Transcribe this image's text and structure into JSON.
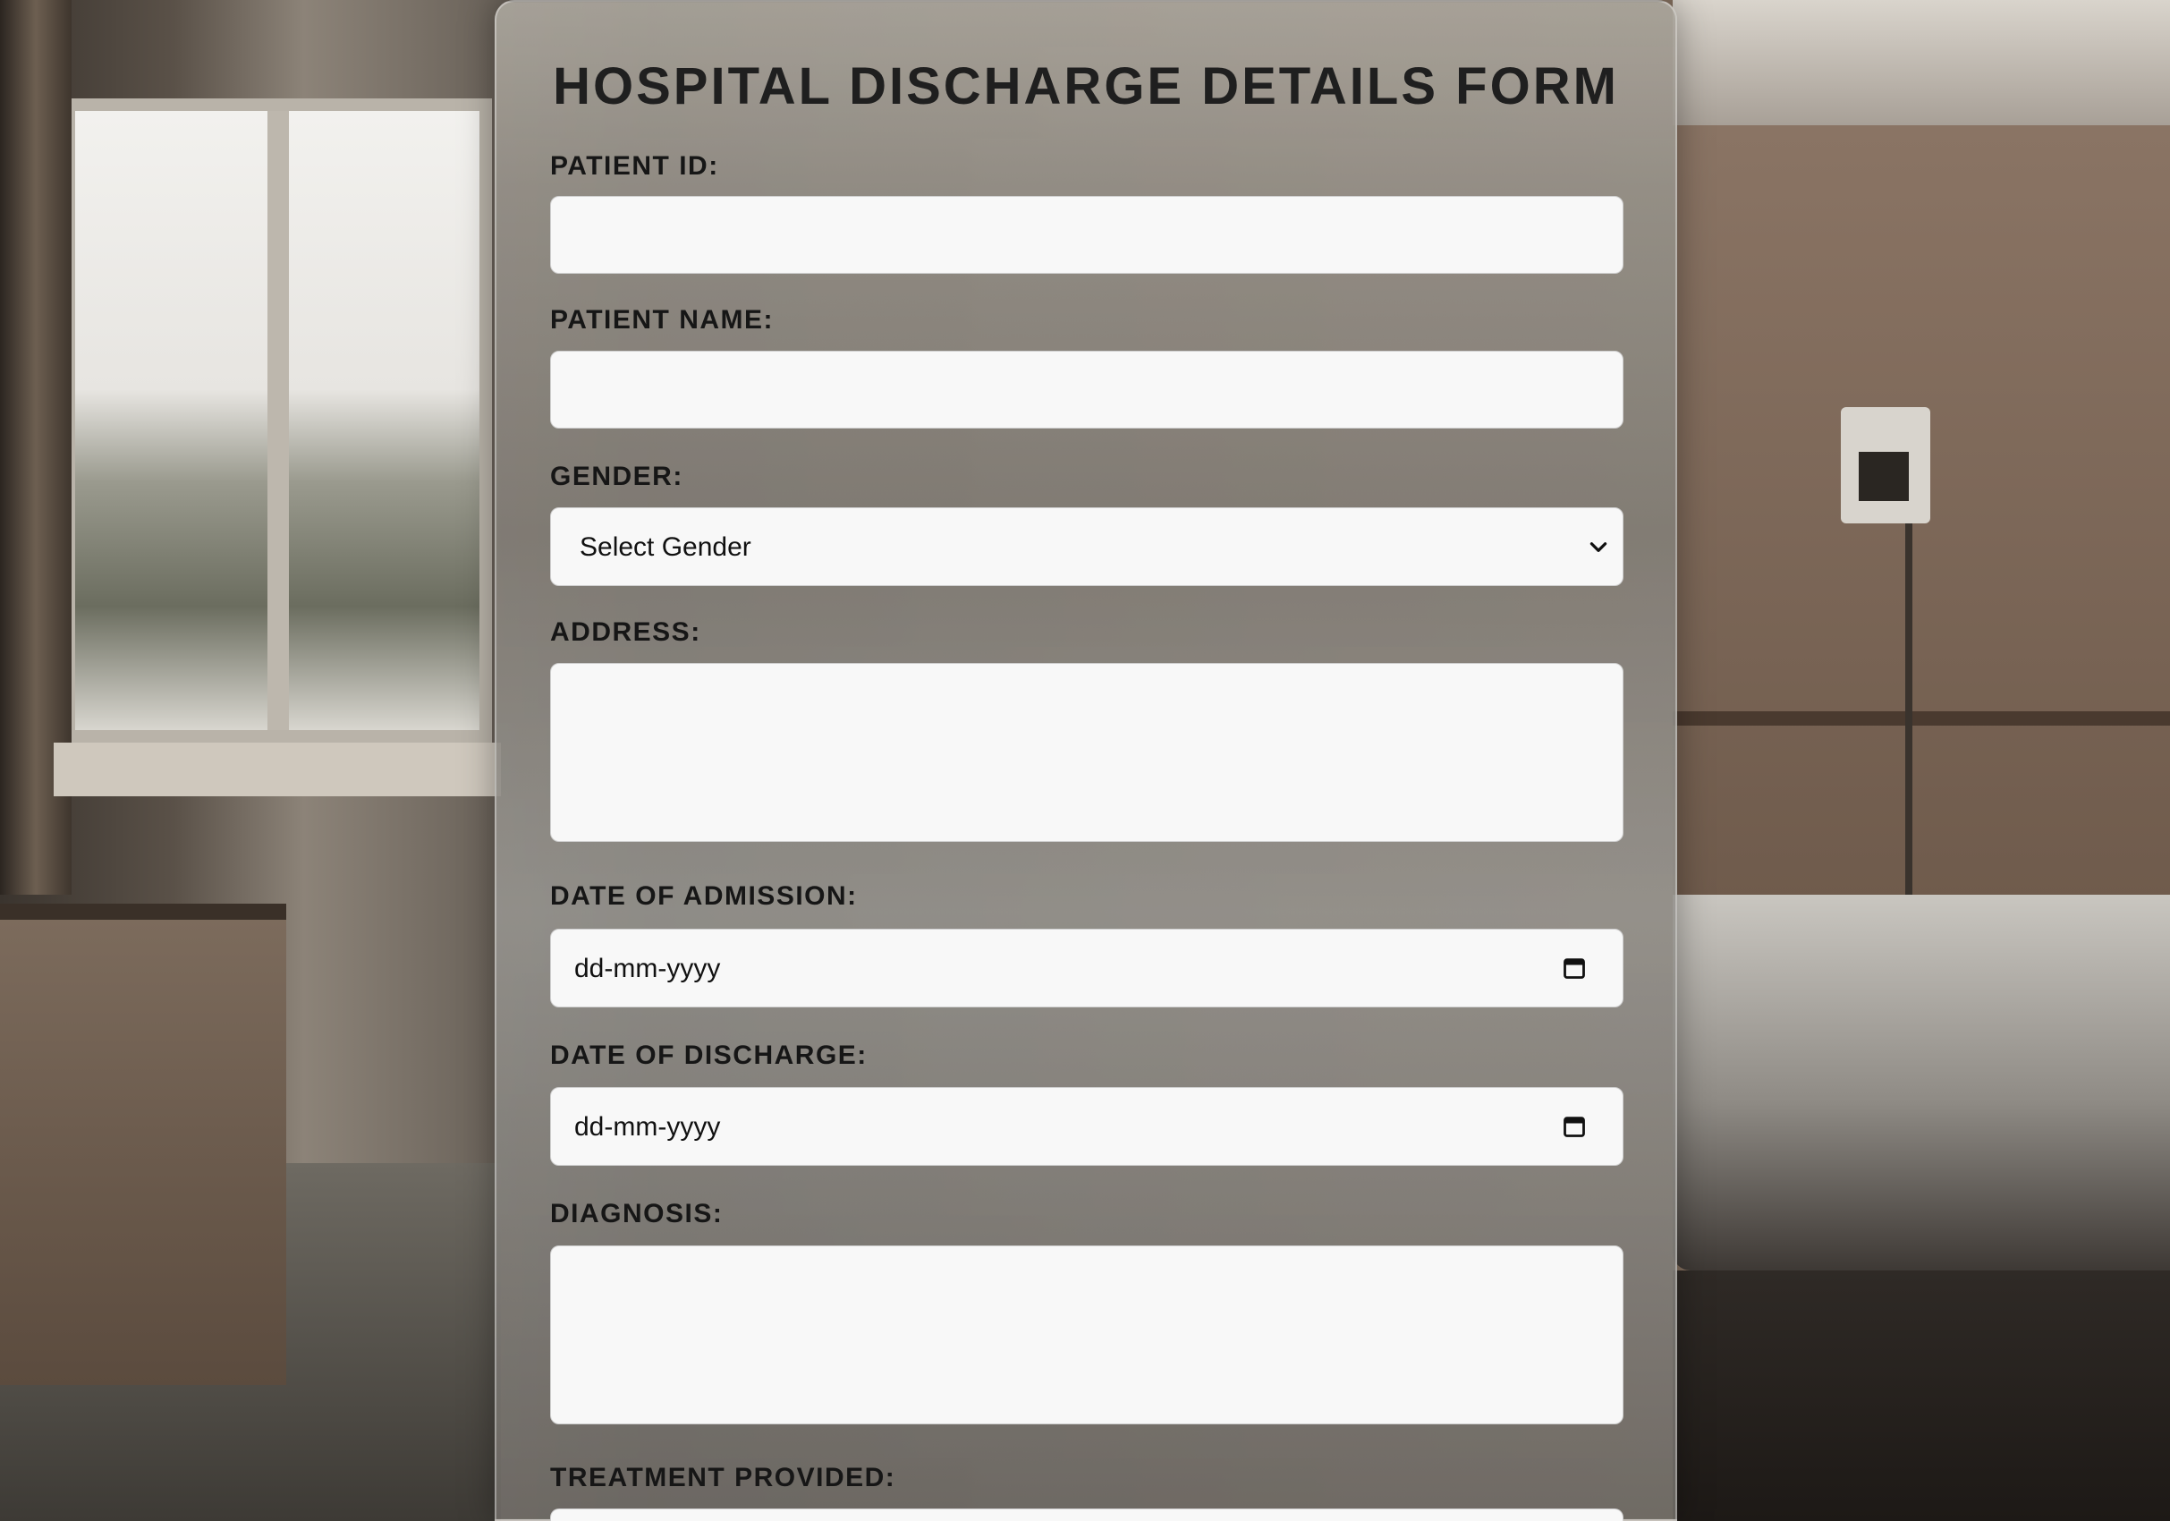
{
  "form": {
    "title": "HOSPITAL DISCHARGE DETAILS FORM",
    "fields": {
      "patient_id": {
        "label": "PATIENT ID:",
        "value": ""
      },
      "patient_name": {
        "label": "PATIENT NAME:",
        "value": ""
      },
      "gender": {
        "label": "GENDER:",
        "selected": "Select Gender"
      },
      "address": {
        "label": "ADDRESS:",
        "value": ""
      },
      "date_of_admission": {
        "label": "DATE OF ADMISSION:",
        "value": "dd-mm-yyyy"
      },
      "date_of_discharge": {
        "label": "DATE OF DISCHARGE:",
        "value": "dd-mm-yyyy"
      },
      "diagnosis": {
        "label": "DIAGNOSIS:",
        "value": ""
      },
      "treatment_provided": {
        "label": "TREATMENT PROVIDED:",
        "value": ""
      }
    }
  },
  "icons": {
    "select": "chevron-down-icon",
    "date": "calendar-icon"
  },
  "colors": {
    "field_bg": "#f8f8f8",
    "label_text": "#161616"
  }
}
